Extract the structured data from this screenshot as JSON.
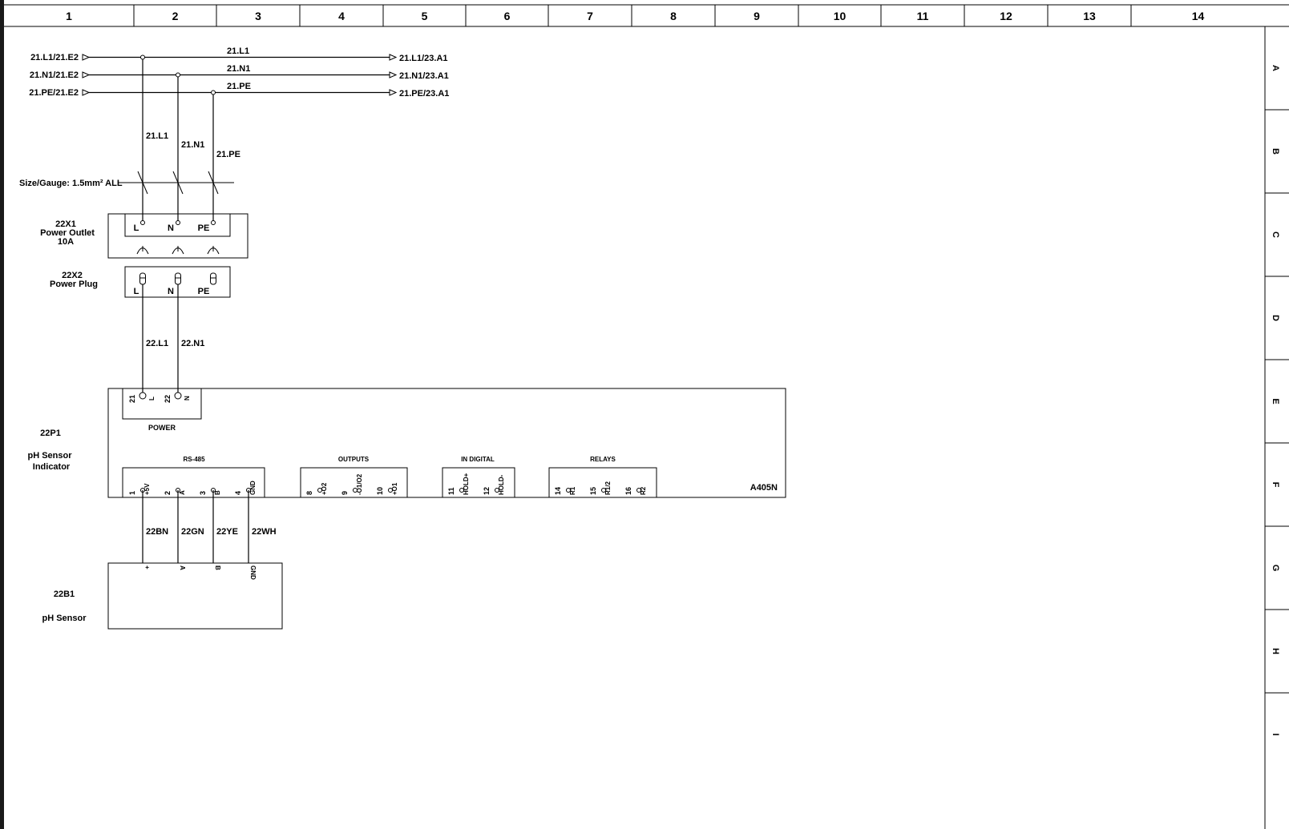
{
  "frame": {
    "columns": [
      "1",
      "2",
      "3",
      "4",
      "5",
      "6",
      "7",
      "8",
      "9",
      "10",
      "11",
      "12",
      "13",
      "14"
    ],
    "rows": [
      "A",
      "B",
      "C",
      "D",
      "E",
      "F",
      "G",
      "H",
      "I"
    ]
  },
  "bus": {
    "sources": [
      "21.L1/21.E2",
      "21.N1/21.E2",
      "21.PE/21.E2"
    ],
    "wires": [
      "21.L1",
      "21.N1",
      "21.PE"
    ],
    "targets": [
      "21.L1/23.A1",
      "21.N1/23.A1",
      "21.PE/23.A1"
    ]
  },
  "drops": [
    "21.L1",
    "21.N1",
    "21.PE"
  ],
  "gauge": "Size/Gauge: 1.5mm² ALL",
  "outlet": {
    "tag": "22X1",
    "name": "Power Outlet",
    "rating": "10A",
    "pins": [
      "L",
      "N",
      "PE"
    ]
  },
  "plug": {
    "tag": "22X2",
    "name": "Power Plug",
    "pins": [
      "L",
      "N",
      "PE"
    ]
  },
  "feed_wires": [
    "22.L1",
    "22.N1"
  ],
  "indicator": {
    "tag": "22P1",
    "name_line1": "pH Sensor",
    "name_line2": "Indicator",
    "model": "A405N",
    "power": {
      "title": "POWER",
      "pin1": "21",
      "pin1_sig": "L",
      "pin2": "22",
      "pin2_sig": "N"
    },
    "rs485": {
      "title": "RS-485",
      "terms": [
        "1",
        "+5V",
        "2",
        "A",
        "3",
        "B",
        "4",
        "GND"
      ]
    },
    "outputs": {
      "title": "OUTPUTS",
      "terms": [
        "8",
        "+O2",
        "9",
        "-O1/O2",
        "10",
        "+O1"
      ]
    },
    "in_digital": {
      "title": "IN DIGITAL",
      "terms": [
        "11",
        "HOLD+",
        "12",
        "HOLD-"
      ]
    },
    "relays": {
      "title": "RELAYS",
      "terms": [
        "14",
        "R1",
        "15",
        "R1/2",
        "16",
        "R2"
      ]
    }
  },
  "sensor_wires": [
    "22BN",
    "22GN",
    "22YE",
    "22WH"
  ],
  "sensor": {
    "tag": "22B1",
    "name": "pH Sensor",
    "pins": [
      "+",
      "A",
      "B",
      "GND"
    ]
  }
}
